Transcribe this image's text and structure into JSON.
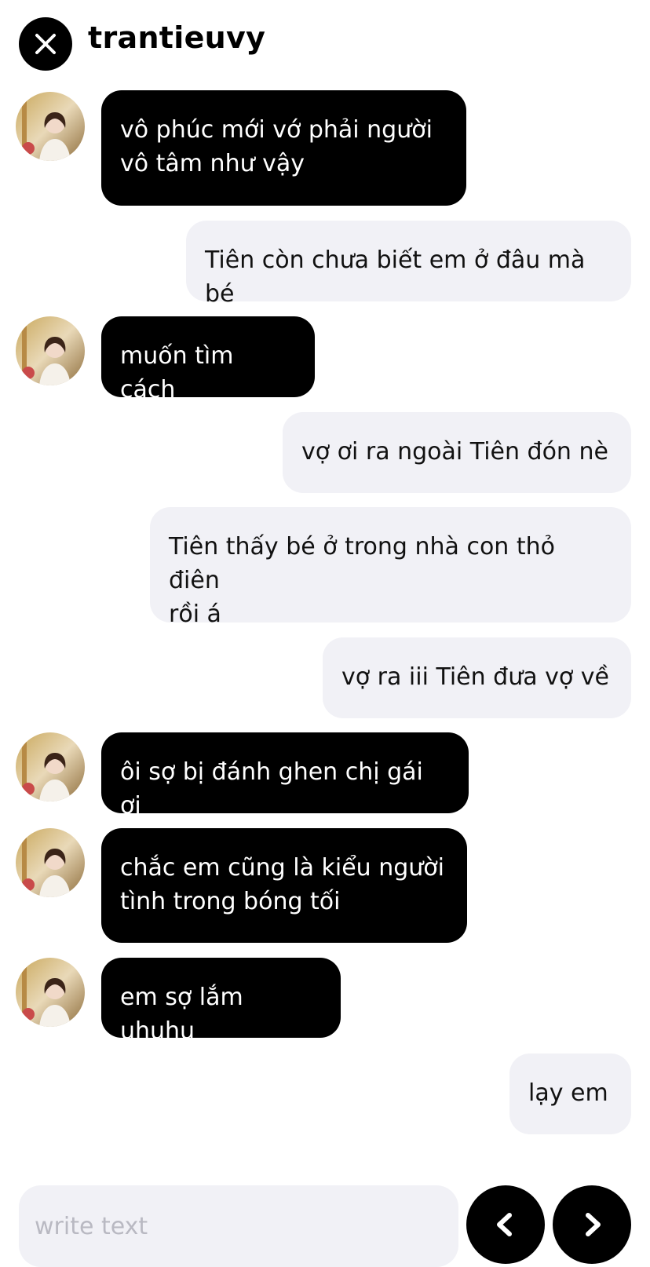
{
  "header": {
    "username": "trantieuvy"
  },
  "messages": [
    {
      "side": "in",
      "text": "vô phúc mới vớ phải người\nvô tâm như vậy"
    },
    {
      "side": "out",
      "text": "Tiên còn chưa biết em ở đâu mà bé"
    },
    {
      "side": "in",
      "text": "muốn tìm cách"
    },
    {
      "side": "out",
      "text": "vợ ơi ra ngoài Tiên đón nè"
    },
    {
      "side": "out",
      "text": "Tiên thấy bé ở trong nhà con thỏ điên\nrồi á"
    },
    {
      "side": "out",
      "text": "vợ ra iii Tiên đưa vợ về"
    },
    {
      "side": "in",
      "text": "ôi sợ bị đánh ghen chị gái ơi"
    },
    {
      "side": "in",
      "text": "chắc em cũng là kiểu người\ntình trong bóng tối"
    },
    {
      "side": "in",
      "text": "em sợ lắm uhuhu"
    },
    {
      "side": "out",
      "text": "lạy em"
    }
  ],
  "composer": {
    "placeholder": "write text",
    "icons": {
      "prev": "chevron-left-icon",
      "next": "chevron-right-icon",
      "close": "close-icon"
    }
  },
  "colors": {
    "incoming_bubble": "#000000",
    "outgoing_bubble": "#f1f1f6",
    "accent": "#000000"
  }
}
